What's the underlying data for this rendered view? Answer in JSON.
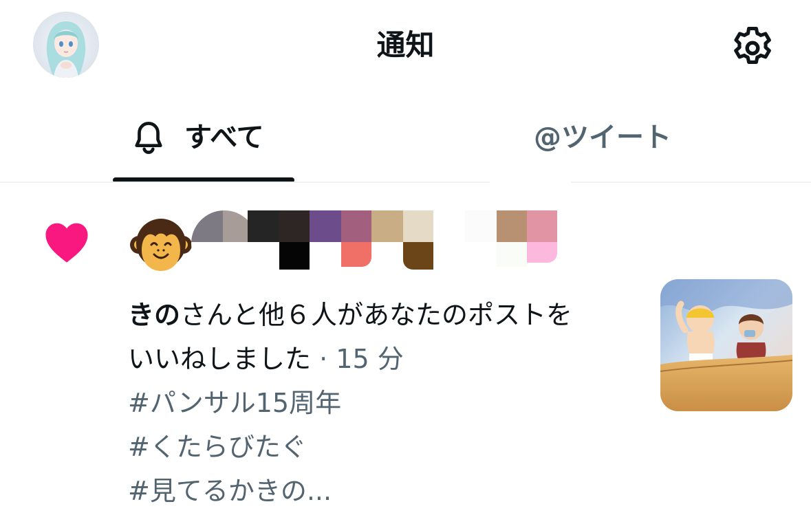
{
  "header": {
    "title": "通知",
    "avatar_icon": "profile-avatar",
    "settings_icon": "gear-icon"
  },
  "tabs": {
    "all": {
      "label": "すべて",
      "icon": "bell-icon"
    },
    "mentions": {
      "label": "@ツイート"
    }
  },
  "notification": {
    "type_icon": "heart-icon",
    "accent_color": "#f91880",
    "actor_name": "きの",
    "message_rest_line1": "さんと他６人があなたのポストを",
    "message_line2": "いいねしました",
    "separator": " · ",
    "timestamp": "15 分",
    "hashtags": [
      "#パンサル15周年",
      "#くたらびたぐ",
      "#見てるかきの..."
    ]
  },
  "colors": {
    "text_primary": "#0f1419",
    "text_secondary": "#536471",
    "like_pink": "#f91880"
  }
}
